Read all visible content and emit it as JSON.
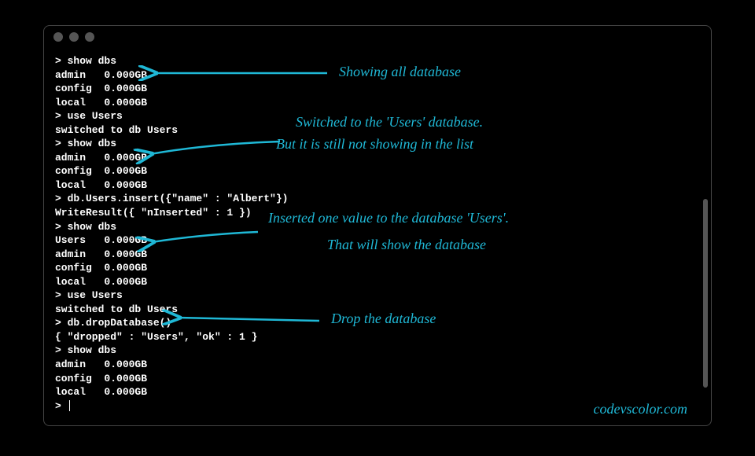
{
  "terminal": {
    "lines": [
      "> show dbs",
      "admin   0.000GB",
      "config  0.000GB",
      "local   0.000GB",
      "> use Users",
      "switched to db Users",
      "> show dbs",
      "admin   0.000GB",
      "config  0.000GB",
      "local   0.000GB",
      "> db.Users.insert({\"name\" : \"Albert\"})",
      "WriteResult({ \"nInserted\" : 1 })",
      "> show dbs",
      "Users   0.000GB",
      "admin   0.000GB",
      "config  0.000GB",
      "local   0.000GB",
      "> use Users",
      "switched to db Users",
      "> db.dropDatabase()",
      "{ \"dropped\" : \"Users\", \"ok\" : 1 }",
      "> show dbs",
      "admin   0.000GB",
      "config  0.000GB",
      "local   0.000GB",
      "> "
    ]
  },
  "annotations": {
    "a1": "Showing all database",
    "a2_line1": "Switched to the 'Users' database.",
    "a2_line2": "But it is still not showing in the list",
    "a3_line1": "Inserted one value to the database 'Users'.",
    "a3_line2": "That will show the database",
    "a4": "Drop the database"
  },
  "watermark": "codevscolor.com",
  "colors": {
    "annotation": "#1fb8d6",
    "terminal_text": "#ffffff",
    "background": "#000000"
  }
}
